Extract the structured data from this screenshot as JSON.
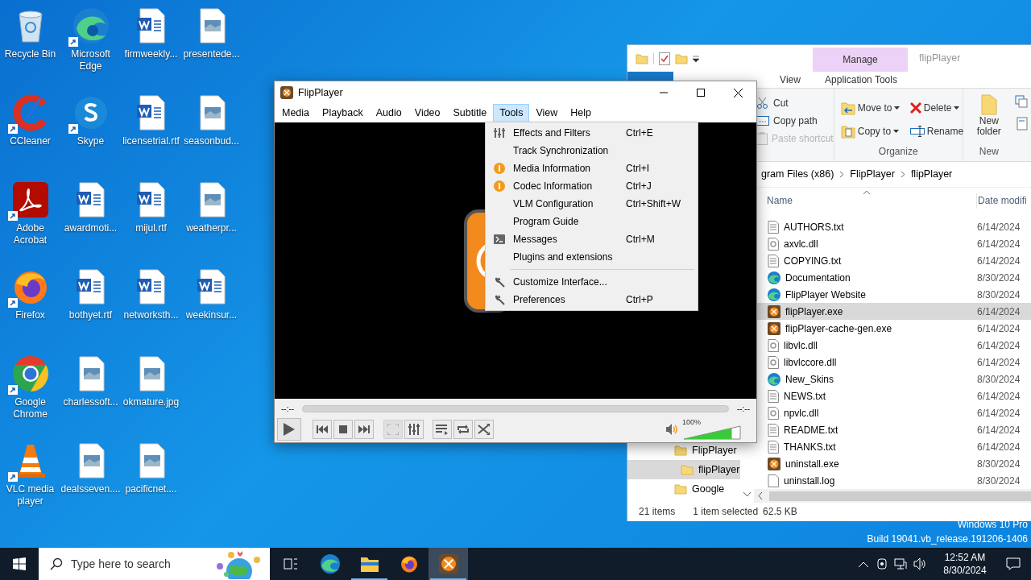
{
  "desktop_columns": [
    [
      {
        "label": "Recycle Bin",
        "kind": "recycle",
        "shortcut": false
      },
      {
        "label": "CCleaner",
        "kind": "ccleaner",
        "shortcut": true
      },
      {
        "label": "Adobe Acrobat",
        "kind": "acrobat",
        "shortcut": true
      },
      {
        "label": "Firefox",
        "kind": "firefox",
        "shortcut": true
      },
      {
        "label": "Google Chrome",
        "kind": "chrome",
        "shortcut": true
      },
      {
        "label": "VLC media player",
        "kind": "vlc",
        "shortcut": true
      }
    ],
    [
      {
        "label": "Microsoft Edge",
        "kind": "edge",
        "shortcut": true
      },
      {
        "label": "Skype",
        "kind": "skype",
        "shortcut": true
      },
      {
        "label": "awardmoti...",
        "kind": "word",
        "shortcut": false
      },
      {
        "label": "bothyet.rtf",
        "kind": "word",
        "shortcut": false
      },
      {
        "label": "charlessoft...",
        "kind": "image",
        "shortcut": false
      },
      {
        "label": "dealsseven....",
        "kind": "image",
        "shortcut": false
      }
    ],
    [
      {
        "label": "firmweekly...",
        "kind": "word",
        "shortcut": false
      },
      {
        "label": "licensetrial.rtf",
        "kind": "word",
        "shortcut": false
      },
      {
        "label": "mijul.rtf",
        "kind": "word",
        "shortcut": false
      },
      {
        "label": "networksth...",
        "kind": "word",
        "shortcut": false
      },
      {
        "label": "okmature.jpg",
        "kind": "image",
        "shortcut": false
      },
      {
        "label": "pacificnet....",
        "kind": "image",
        "shortcut": false
      }
    ],
    [
      {
        "label": "presentede...",
        "kind": "image",
        "shortcut": false
      },
      {
        "label": "seasonbud...",
        "kind": "image",
        "shortcut": false
      },
      {
        "label": "weatherpr...",
        "kind": "image",
        "shortcut": false
      },
      {
        "label": "weekinsur...",
        "kind": "word",
        "shortcut": false
      }
    ]
  ],
  "explorer": {
    "title": "flipPlayer",
    "context_group": "Manage",
    "tabs": [
      {
        "label": "View",
        "kind": "tab",
        "selected": false
      },
      {
        "label": "Application Tools",
        "kind": "context",
        "selected": false
      }
    ],
    "clipboard": [
      {
        "label": "Cut",
        "kind": "cut",
        "disabled": false
      },
      {
        "label": "Copy path",
        "kind": "copypath",
        "disabled": false
      },
      {
        "label": "Paste shortcut",
        "kind": "paste",
        "disabled": true
      }
    ],
    "organize": {
      "label": "Organize",
      "items": [
        {
          "label": "Move to",
          "kind": "move"
        },
        {
          "label": "Delete",
          "kind": "delete"
        },
        {
          "label": "Copy to",
          "kind": "copy"
        },
        {
          "label": "Rename",
          "kind": "rename"
        }
      ]
    },
    "new_group": {
      "label": "New",
      "button": "New folder"
    },
    "path": [
      "gram Files (x86)",
      "FlipPlayer",
      "flipPlayer"
    ],
    "columns": [
      "Name",
      "Date modifi"
    ],
    "nav": [
      {
        "label": "FlipPlayer",
        "selected": false,
        "children": [
          {
            "label": "flipPlayer",
            "selected": true
          }
        ]
      },
      {
        "label": "Google",
        "selected": false
      }
    ],
    "files": [
      {
        "name": "AUTHORS.txt",
        "kind": "text",
        "date": "6/14/2024",
        "selected": false
      },
      {
        "name": "axvlc.dll",
        "kind": "dll",
        "date": "6/14/2024",
        "selected": false
      },
      {
        "name": "COPYING.txt",
        "kind": "text",
        "date": "6/14/2024",
        "selected": false
      },
      {
        "name": "Documentation",
        "kind": "link",
        "date": "8/30/2024",
        "selected": false
      },
      {
        "name": "FlipPlayer Website",
        "kind": "link",
        "date": "8/30/2024",
        "selected": false
      },
      {
        "name": "flipPlayer.exe",
        "kind": "exe",
        "date": "6/14/2024",
        "selected": true
      },
      {
        "name": "flipPlayer-cache-gen.exe",
        "kind": "exe",
        "date": "6/14/2024",
        "selected": false
      },
      {
        "name": "libvlc.dll",
        "kind": "dll",
        "date": "6/14/2024",
        "selected": false
      },
      {
        "name": "libvlccore.dll",
        "kind": "dll",
        "date": "6/14/2024",
        "selected": false
      },
      {
        "name": "New_Skins",
        "kind": "link",
        "date": "8/30/2024",
        "selected": false
      },
      {
        "name": "NEWS.txt",
        "kind": "text",
        "date": "6/14/2024",
        "selected": false
      },
      {
        "name": "npvlc.dll",
        "kind": "dll",
        "date": "6/14/2024",
        "selected": false
      },
      {
        "name": "README.txt",
        "kind": "text",
        "date": "6/14/2024",
        "selected": false
      },
      {
        "name": "THANKS.txt",
        "kind": "text",
        "date": "6/14/2024",
        "selected": false
      },
      {
        "name": "uninstall.exe",
        "kind": "exe",
        "date": "8/30/2024",
        "selected": false
      },
      {
        "name": "uninstall.log",
        "kind": "log",
        "date": "8/30/2024",
        "selected": false
      }
    ],
    "status": {
      "count": "21 items",
      "selection": "1 item selected",
      "size": "62.5 KB"
    }
  },
  "player": {
    "title": "FlipPlayer",
    "menu": [
      {
        "label": "Media",
        "selected": false
      },
      {
        "label": "Playback",
        "selected": false
      },
      {
        "label": "Audio",
        "selected": false
      },
      {
        "label": "Video",
        "selected": false
      },
      {
        "label": "Subtitle",
        "selected": false
      },
      {
        "label": "Tools",
        "selected": true
      },
      {
        "label": "View",
        "selected": false
      },
      {
        "label": "Help",
        "selected": false
      }
    ],
    "tools_menu": [
      {
        "kind": "effects",
        "label": "Effects and Filters",
        "shortcut": "Ctrl+E"
      },
      {
        "kind": "plain",
        "label": "Track Synchronization"
      },
      {
        "kind": "info",
        "label": "Media Information",
        "shortcut": "Ctrl+I"
      },
      {
        "kind": "info",
        "label": "Codec Information",
        "shortcut": "Ctrl+J"
      },
      {
        "kind": "plain",
        "label": "VLM Configuration",
        "shortcut": "Ctrl+Shift+W"
      },
      {
        "kind": "plain",
        "label": "Program Guide"
      },
      {
        "kind": "messages",
        "label": "Messages",
        "shortcut": "Ctrl+M"
      },
      {
        "kind": "plain",
        "label": "Plugins and extensions"
      },
      {
        "kind": "separator"
      },
      {
        "kind": "wrench",
        "label": "Customize Interface..."
      },
      {
        "kind": "wrench",
        "label": "Preferences",
        "shortcut": "Ctrl+P"
      }
    ],
    "elapsed": "--:--",
    "remaining": "--:--",
    "volume": {
      "label": "100%",
      "level": 0.85
    }
  },
  "os_notice": [
    "Windows 10 Pro",
    "Build 19041.vb_release.191206-1406"
  ],
  "taskbar": {
    "search_placeholder": "Type here to search",
    "apps": [
      {
        "kind": "taskview",
        "running": false,
        "selected": false
      },
      {
        "kind": "edge",
        "running": false,
        "selected": false
      },
      {
        "kind": "explorer",
        "running": true,
        "selected": false
      },
      {
        "kind": "firefox",
        "running": false,
        "selected": false
      },
      {
        "kind": "flipplayer",
        "running": true,
        "selected": true
      }
    ],
    "time": "12:52 AM",
    "date": "8/30/2024"
  }
}
